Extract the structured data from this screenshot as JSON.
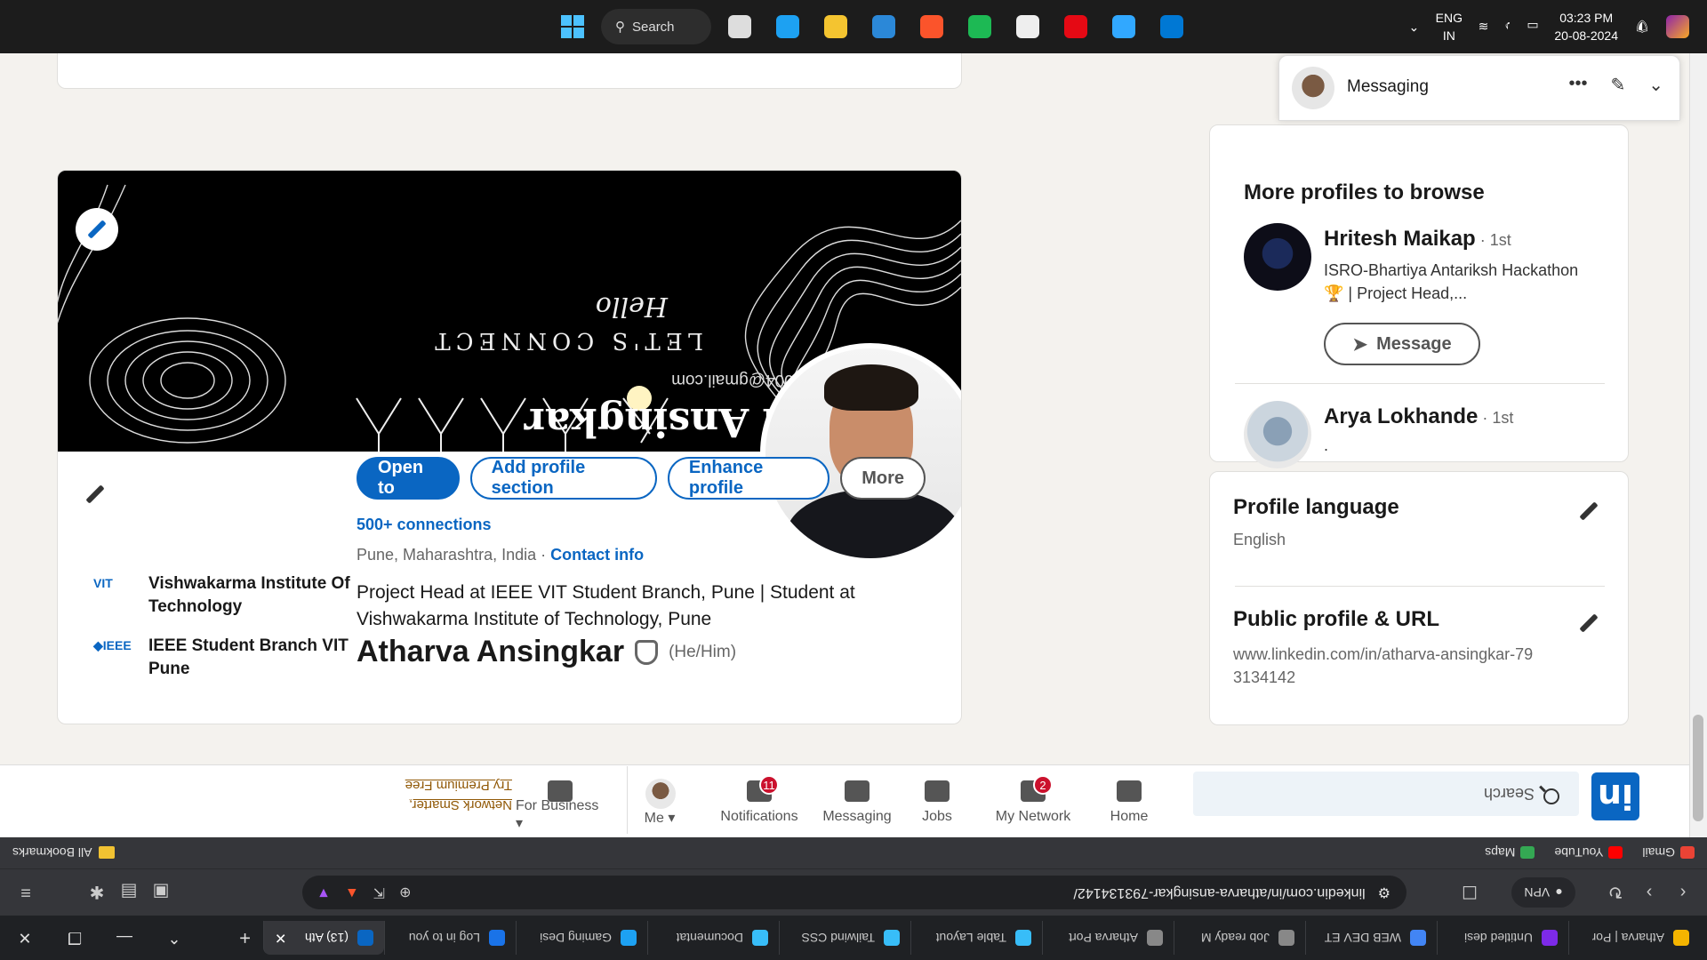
{
  "browser": {
    "tabs": [
      {
        "label": "Atharva | Por",
        "color": "#f4b400"
      },
      {
        "label": "Untitled desi",
        "color": "#7d2ae8"
      },
      {
        "label": "WEB DEV ET",
        "color": "#4285f4"
      },
      {
        "label": "Job ready M",
        "color": "#888888"
      },
      {
        "label": "Atharva Port",
        "color": "#888888"
      },
      {
        "label": "Table Layout",
        "color": "#38bdf8"
      },
      {
        "label": "Tailwind CSS",
        "color": "#38bdf8"
      },
      {
        "label": "Documentat",
        "color": "#38bdf8"
      },
      {
        "label": "Gaming Desi",
        "color": "#1da1f2"
      },
      {
        "label": "Log in to you",
        "color": "#1a73e8"
      }
    ],
    "active_tab": {
      "label": "(13) Ath",
      "color": "#0a66c2"
    },
    "new_tab": "+",
    "url": "linkedin.com/in/atharva-ansingkar-793134142/",
    "vpn_label": "VPN",
    "bookmarks": [
      {
        "label": "Gmail",
        "color": "#ea4335"
      },
      {
        "label": "YouTube",
        "color": "#ff0000"
      },
      {
        "label": "Maps",
        "color": "#34a853"
      }
    ],
    "all_bookmarks": "All Bookmarks"
  },
  "linkedin": {
    "search_placeholder": "Search",
    "logo": "in",
    "nav": [
      {
        "label": "Home",
        "badge": "",
        "icon": "home-icon"
      },
      {
        "label": "My Network",
        "badge": "2",
        "icon": "network-icon"
      },
      {
        "label": "Jobs",
        "badge": "",
        "icon": "jobs-icon"
      },
      {
        "label": "Messaging",
        "badge": "",
        "icon": "messaging-icon"
      },
      {
        "label": "Notifications",
        "badge": "11",
        "icon": "bell-icon"
      },
      {
        "label": "Me ▾",
        "badge": "",
        "icon": "avatar"
      },
      {
        "label": "For Business ▾",
        "badge": "",
        "icon": "grid-icon"
      }
    ],
    "premium": [
      "Network Smarter,",
      "Try Premium Free"
    ]
  },
  "profile": {
    "banner": {
      "name": "Atharva Ansingkar",
      "email": "atharvaansingkar2004@gmail.com",
      "tagline": "LET'S CONNECT",
      "greeting": "Hello"
    },
    "name": "Atharva Ansingkar",
    "pronouns": "(He/Him)",
    "headline": "Project Head at IEEE VIT Student Branch, Pune | Student at Vishwakarma Institute of Technology, Pune",
    "location": "Pune, Maharashtra, India · ",
    "contact_info": "Contact info",
    "connections": "500+ connections",
    "experience": [
      {
        "logo": "◆IEEE",
        "text": "IEEE Student Branch VIT Pune"
      },
      {
        "logo": "VIT",
        "text": "Vishwakarma Institute Of Technology"
      }
    ],
    "actions": {
      "open_to": "Open to",
      "add_section": "Add profile section",
      "enhance": "Enhance profile",
      "more": "More"
    }
  },
  "rail": {
    "profile_language": {
      "title": "Profile language",
      "value": "English"
    },
    "public_profile": {
      "title": "Public profile & URL",
      "value": "www.linkedin.com/in/atharva-ansingkar-793134142"
    },
    "more_profiles": "More profiles to browse",
    "people": [
      {
        "name": "Hritesh Maikap",
        "degree": " · 1st",
        "headline": "ISRO-Bhartiya Antariksh Hackathon 🏆 | Project Head,...",
        "button": "Message"
      },
      {
        "name": "Arya Lokhande",
        "degree": " · 1st",
        "headline": ".",
        "button": ""
      }
    ],
    "messaging": "Messaging"
  },
  "taskbar": {
    "search": "Search",
    "lang": [
      "ENG",
      "IN"
    ],
    "time": "03:23 PM",
    "date": "20-08-2024",
    "apps": [
      {
        "name": "task-view",
        "color": "#dddddd"
      },
      {
        "name": "edge",
        "color": "#1da1f2"
      },
      {
        "name": "file-explorer",
        "color": "#f4c430"
      },
      {
        "name": "copilot",
        "color": "#2b88d8"
      },
      {
        "name": "brave",
        "color": "#fb542b"
      },
      {
        "name": "spotify",
        "color": "#1db954"
      },
      {
        "name": "store",
        "color": "#eeeeee"
      },
      {
        "name": "netflix",
        "color": "#e50914"
      },
      {
        "name": "photoshop",
        "color": "#31a8ff"
      },
      {
        "name": "vscode",
        "color": "#0078d4"
      }
    ]
  }
}
